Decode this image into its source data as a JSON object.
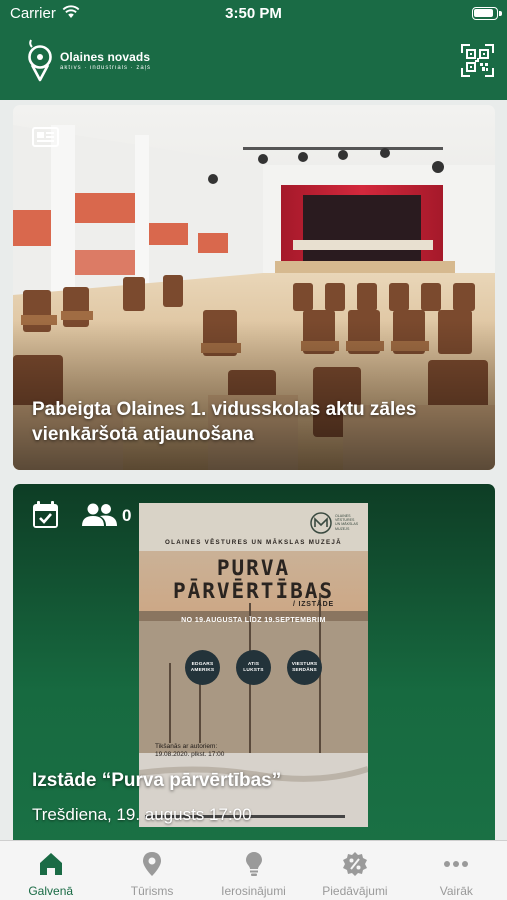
{
  "status_bar": {
    "carrier": "Carrier",
    "time": "3:50 PM"
  },
  "header": {
    "logo_title": "Olaines novads",
    "logo_tagline": "aktīvs · industriāls · zaļš"
  },
  "news_card": {
    "title": "Pabeigta Olaines 1. vidusskolas aktu zāles vienkāršotā atjaunošana"
  },
  "event_card": {
    "attendees": "0",
    "title": "Izstāde “Purva pārvērtības”",
    "date": "Trešdiena, 19. augusts 17:00",
    "poster": {
      "organizer": "OLAINES VĒSTURES UN MĀKSLAS MUZEJĀ",
      "title_line1": "PURVA",
      "title_line2": "PĀRVĒRTĪBAS",
      "subtitle": "/ IZSTĀDE",
      "dates": "NO 19.AUGUSTA LĪDZ 19.SEPTEMBRIM",
      "logo_text_1": "OLAINES",
      "logo_text_2": "VĒSTURES",
      "logo_text_3": "UN MĀKSLAS",
      "logo_text_4": "MUZEJS",
      "artist_1_first": "EDGARS",
      "artist_1_last": "AMERIKS",
      "artist_2_first": "ATIS",
      "artist_2_last": "LUKSTS",
      "artist_3_first": "VIESTURS",
      "artist_3_last": "SERDĀNS",
      "meeting_line1": "Tikšanās ar autoriem:",
      "meeting_line2": "19.08.2020. plkst. 17:00"
    }
  },
  "tabs": [
    {
      "label": "Galvenā",
      "icon": "home-icon",
      "active": true
    },
    {
      "label": "Tūrisms",
      "icon": "map-pin-icon",
      "active": false
    },
    {
      "label": "Ierosinājumi",
      "icon": "lightbulb-icon",
      "active": false
    },
    {
      "label": "Piedāvājumi",
      "icon": "percent-badge-icon",
      "active": false
    },
    {
      "label": "Vairāk",
      "icon": "more-dots-icon",
      "active": false
    }
  ],
  "colors": {
    "brand_green": "#1a6b45",
    "tab_active": "#1a6b45",
    "tab_inactive": "#9a9a9a"
  }
}
